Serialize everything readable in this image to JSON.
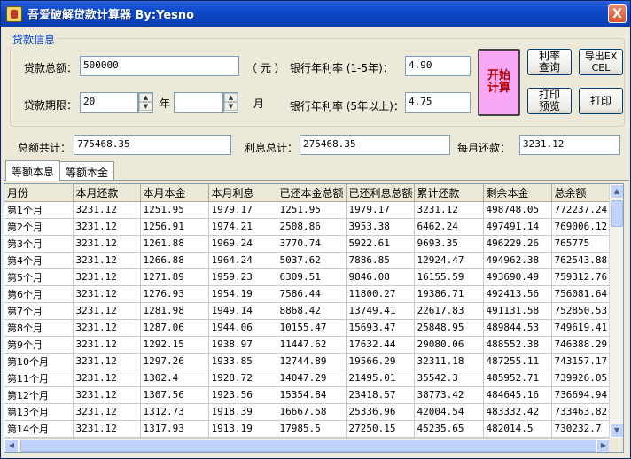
{
  "window": {
    "title": "吾爱破解贷款计算器 By:Yesno",
    "close_label": "X"
  },
  "form": {
    "group_title": "贷款信息",
    "total_label": "贷款总额：",
    "total_value": "500000",
    "total_unit": "（ 元 ）",
    "term_label": "贷款期限：",
    "term_years": "20",
    "years_unit": "年",
    "term_months": "",
    "months_unit": "月",
    "rate_short_label": "银行年利率 (1-5年)：",
    "rate_short_value": "4.90",
    "rate_long_label": "银行年利率 (5年以上)：",
    "rate_long_value": "4.75"
  },
  "buttons": {
    "start": "开始计算",
    "rate_query": "利率查询",
    "export": "导出EXCEL",
    "print_preview": "打印预览",
    "print": "打印"
  },
  "summary": {
    "total_label": "总额共计：",
    "total_value": "775468.35",
    "interest_label": "利息总计：",
    "interest_value": "275468.35",
    "monthly_label": "每月还款：",
    "monthly_value": "3231.12"
  },
  "tabs": [
    "等额本息",
    "等额本金"
  ],
  "table": {
    "columns": [
      "月份",
      "本月还款",
      "本月本金",
      "本月利息",
      "已还本金总额",
      "已还利息总额",
      "累计还款",
      "剩余本金",
      "总余额"
    ],
    "rows": [
      [
        "第1个月",
        "3231.12",
        "1251.95",
        "1979.17",
        "1251.95",
        "1979.17",
        "3231.12",
        "498748.05",
        "772237.24"
      ],
      [
        "第2个月",
        "3231.12",
        "1256.91",
        "1974.21",
        "2508.86",
        "3953.38",
        "6462.24",
        "497491.14",
        "769006.12"
      ],
      [
        "第3个月",
        "3231.12",
        "1261.88",
        "1969.24",
        "3770.74",
        "5922.61",
        "9693.35",
        "496229.26",
        "765775"
      ],
      [
        "第4个月",
        "3231.12",
        "1266.88",
        "1964.24",
        "5037.62",
        "7886.85",
        "12924.47",
        "494962.38",
        "762543.88"
      ],
      [
        "第5个月",
        "3231.12",
        "1271.89",
        "1959.23",
        "6309.51",
        "9846.08",
        "16155.59",
        "493690.49",
        "759312.76"
      ],
      [
        "第6个月",
        "3231.12",
        "1276.93",
        "1954.19",
        "7586.44",
        "11800.27",
        "19386.71",
        "492413.56",
        "756081.64"
      ],
      [
        "第7个月",
        "3231.12",
        "1281.98",
        "1949.14",
        "8868.42",
        "13749.41",
        "22617.83",
        "491131.58",
        "752850.53"
      ],
      [
        "第8个月",
        "3231.12",
        "1287.06",
        "1944.06",
        "10155.47",
        "15693.47",
        "25848.95",
        "489844.53",
        "749619.41"
      ],
      [
        "第9个月",
        "3231.12",
        "1292.15",
        "1938.97",
        "11447.62",
        "17632.44",
        "29080.06",
        "488552.38",
        "746388.29"
      ],
      [
        "第10个月",
        "3231.12",
        "1297.26",
        "1933.85",
        "12744.89",
        "19566.29",
        "32311.18",
        "487255.11",
        "743157.17"
      ],
      [
        "第11个月",
        "3231.12",
        "1302.4",
        "1928.72",
        "14047.29",
        "21495.01",
        "35542.3",
        "485952.71",
        "739926.05"
      ],
      [
        "第12个月",
        "3231.12",
        "1307.56",
        "1923.56",
        "15354.84",
        "23418.57",
        "38773.42",
        "484645.16",
        "736694.94"
      ],
      [
        "第13个月",
        "3231.12",
        "1312.73",
        "1918.39",
        "16667.58",
        "25336.96",
        "42004.54",
        "483332.42",
        "733463.82"
      ],
      [
        "第14个月",
        "3231.12",
        "1317.93",
        "1913.19",
        "17985.5",
        "27250.15",
        "45235.65",
        "482014.5",
        "730232.7"
      ]
    ]
  }
}
